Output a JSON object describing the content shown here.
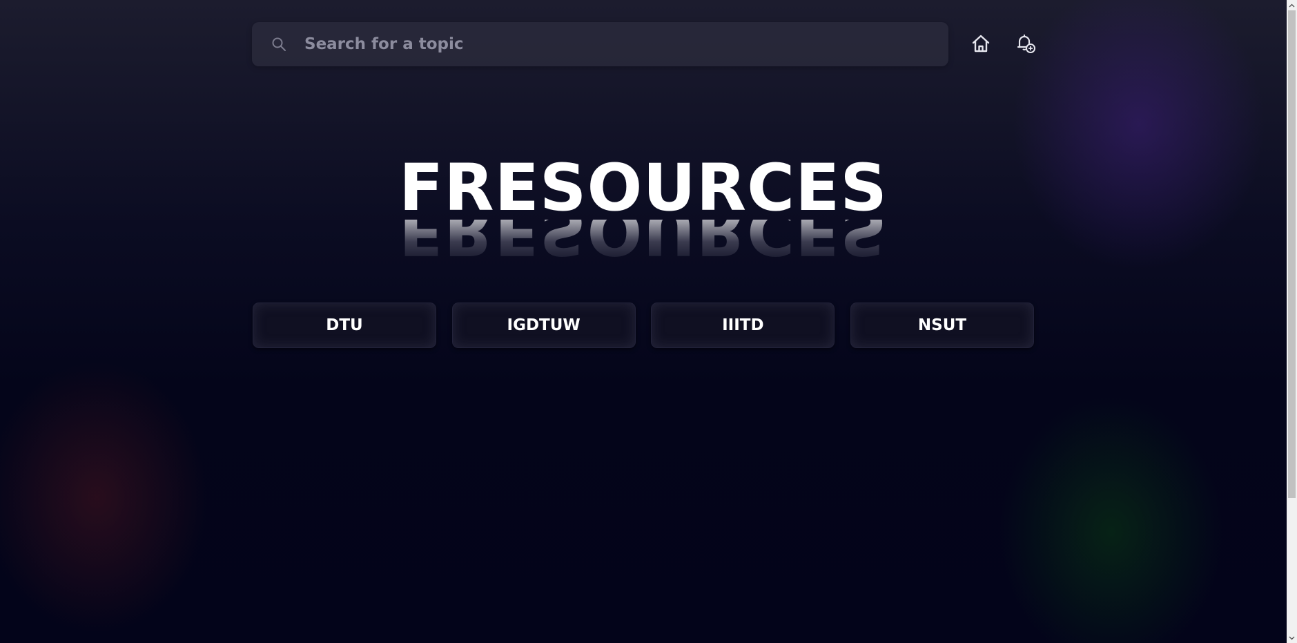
{
  "search": {
    "placeholder": "Search for a topic",
    "icon": "search-icon"
  },
  "nav": {
    "home_icon": "home-icon",
    "notification_icon": "bell-plus-icon"
  },
  "hero": {
    "title": "FRESOURCES"
  },
  "colleges": [
    {
      "label": "DTU"
    },
    {
      "label": "IGDTUW"
    },
    {
      "label": "IIITD"
    },
    {
      "label": "NSUT"
    }
  ],
  "colors": {
    "background": "#05061a",
    "search_bg": "#2c2c3e",
    "button_bg": "#101022",
    "glow_purple": "#3c1e78",
    "glow_red": "#46141e",
    "glow_green": "#083214"
  }
}
